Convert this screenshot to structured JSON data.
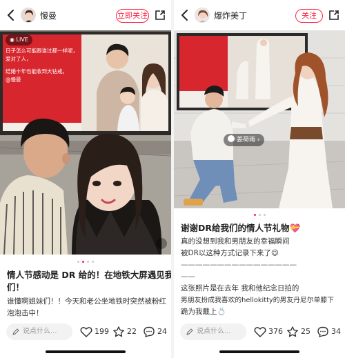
{
  "left": {
    "username": "慢曼",
    "follow_label": "立即关注",
    "live_label": "LIVE",
    "title": "情人节感动是 DR 给的！在地铁大屏遇见我们！",
    "title_line1": "情人节感动是 DR 给的！在地铁大屏遇见我",
    "title_line2": "们！",
    "body_line1": "谁懂啊姐妹们！！今天和老公坐地铁时突然被粉红",
    "body_line2": "泡泡击中！",
    "billboard_line1": "日子怎么可能跟谁过都一样呢，",
    "billboard_line2": "爱对了人，",
    "billboard_line3": "结婚十年也能收到大钻戒。",
    "billboard_handle": "@慢曼",
    "comment_placeholder": "说点什么...",
    "likes": "199",
    "stars": "22",
    "comments": "24"
  },
  "right": {
    "username": "爆炸美丁",
    "follow_label": "关注",
    "tag_label": "姜荷雨",
    "title": "谢谢DR给我们的情人节礼物💝",
    "body_line1": "真的没想到我和男朋友的幸福瞬间",
    "body_line2": "被DR以这种方式记录下来了😉",
    "body_line3": "————————————————",
    "body_line4": "——",
    "body_line5": "这张照片是在去年 我和他纪念日拍的",
    "body_line6": "男朋友扮成我喜欢的hellokitty的男友丹尼尔单膝下",
    "body_line7": "跪为我戴上💍",
    "comment_placeholder": "说点什么...",
    "likes": "376",
    "stars": "25",
    "comments": "34"
  },
  "colors": {
    "accent": "#ff2442",
    "billboard_red": "#d8262e"
  },
  "icons": [
    "back-arrow-icon",
    "share-icon",
    "pen-icon",
    "heart-icon",
    "star-icon",
    "comment-bubble-icon",
    "live-icon"
  ]
}
